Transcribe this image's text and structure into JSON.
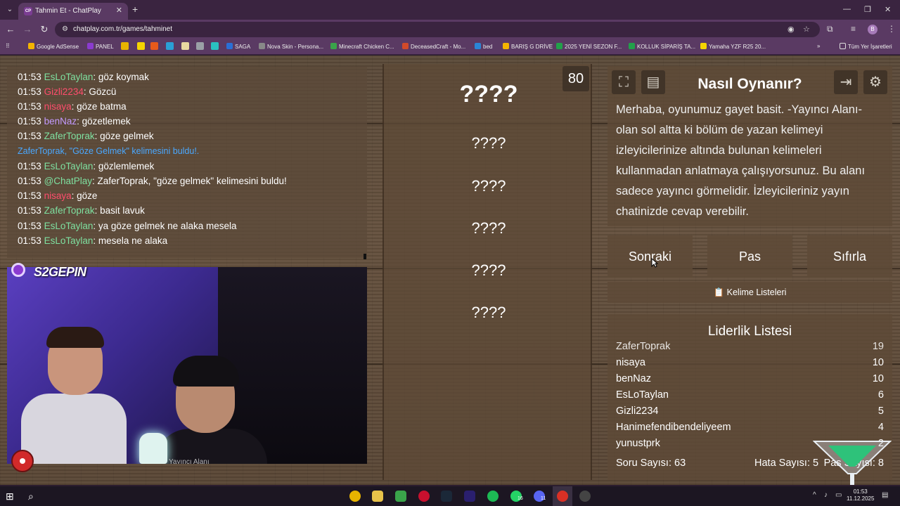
{
  "browser": {
    "tab_title": "Tahmin Et - ChatPlay",
    "tab_favicon": "CP",
    "url": "chatplay.com.tr/games/tahminet",
    "profile_initial": "B",
    "bookmarks": [
      {
        "label": "Google AdSense",
        "color": "#f4b400"
      },
      {
        "label": "PANEL",
        "color": "#8b3bd0"
      },
      {
        "label": "SAGA",
        "color": "#2a6fd6"
      },
      {
        "label": "Nova Skin - Persona...",
        "color": "#888888"
      },
      {
        "label": "Minecraft Chicken C...",
        "color": "#3aa34a"
      },
      {
        "label": "DeceasedCraft - Mo...",
        "color": "#d14a2a"
      },
      {
        "label": "bed",
        "color": "#2a86d6"
      },
      {
        "label": "BARIŞ G DRİVE",
        "color": "#f4b400"
      },
      {
        "label": "2025 YENİ SEZON F...",
        "color": "#22a04a"
      },
      {
        "label": "KOLLUK SİPARİŞ TA...",
        "color": "#22a04a"
      },
      {
        "label": "Yamaha YZF R25 20...",
        "color": "#f4d400"
      }
    ],
    "all_bookmarks": "Tüm Yer İşaretleri"
  },
  "chat": {
    "lines": [
      {
        "time": "01:53",
        "user": "EsLoTaylan",
        "color": "#7ee0a0",
        "msg": ": göz koymak"
      },
      {
        "time": "01:53",
        "user": "Gizli2234",
        "color": "#ff4d6d",
        "msg": ": Gözcü"
      },
      {
        "time": "01:53",
        "user": "nisaya",
        "color": "#ff4d6d",
        "msg": ": göze batma"
      },
      {
        "time": "01:53",
        "user": "benNaz",
        "color": "#c39bff",
        "msg": ": gözetlemek"
      },
      {
        "time": "01:53",
        "user": "ZaferToprak",
        "color": "#7ee0a0",
        "msg": ": göze gelmek"
      },
      {
        "system": "ZaferToprak, \"Göze Gelmek\" kelimesini buldu!."
      },
      {
        "time": "01:53",
        "user": "EsLoTaylan",
        "color": "#7ee0a0",
        "msg": ": gözlemlemek"
      },
      {
        "time": "01:53",
        "user": "@ChatPlay",
        "color": "#7ee0a0",
        "msg": ": ZaferToprak, \"göze gelmek\" kelimesini buldu!"
      },
      {
        "time": "01:53",
        "user": "nisaya",
        "color": "#ff4d6d",
        "msg": ": göze"
      },
      {
        "time": "01:53",
        "user": "ZaferToprak",
        "color": "#7ee0a0",
        "msg": ": basit lavuk"
      },
      {
        "time": "01:53",
        "user": "EsLoTaylan",
        "color": "#7ee0a0",
        "msg": ": ya göze gelmek ne alaka mesela"
      },
      {
        "time": "01:53",
        "user": "EsLoTaylan",
        "color": "#7ee0a0",
        "msg": ": mesela ne alaka"
      }
    ]
  },
  "stream": {
    "logo_text": "S2GEPIN",
    "caption": "Yayıncı Alanı"
  },
  "words": {
    "main": "????",
    "hidden": [
      "????",
      "????",
      "????",
      "????",
      "????"
    ],
    "timer": "80"
  },
  "howto": {
    "title": "Nasıl Oynanır?",
    "text": "Merhaba, oyunumuz gayet basit. -Yayıncı Alanı- olan sol altta ki bölüm de yazan kelimeyi izleyicilerinize altında bulunan kelimeleri kullanmadan anlatmaya çalışıyorsunuz. Bu alanı sadece yayıncı görmelidir. İzleyicileriniz yayın chatinizde cevap verebilir."
  },
  "actions": {
    "next": "Sonraki",
    "pass": "Pas",
    "reset": "Sıfırla",
    "word_lists": "Kelime Listeleri"
  },
  "leaderboard": {
    "title": "Liderlik Listesi",
    "rows": [
      {
        "name": "ZaferToprak",
        "score": "19"
      },
      {
        "name": "nisaya",
        "score": "10"
      },
      {
        "name": "benNaz",
        "score": "10"
      },
      {
        "name": "EsLoTaylan",
        "score": "6"
      },
      {
        "name": "Gizli2234",
        "score": "5"
      },
      {
        "name": "Hanimefendibendeliyeem",
        "score": "4"
      },
      {
        "name": "yunustprk",
        "score": "2"
      }
    ],
    "questions": "Soru Sayısı: 63",
    "errors": "Hata Sayısı: 5",
    "passes": "Pas Sayısı: 8"
  },
  "taskbar": {
    "time": "01:53",
    "date": "11.12.2025",
    "whatsapp_badge": "16",
    "discord_badge": "11"
  }
}
